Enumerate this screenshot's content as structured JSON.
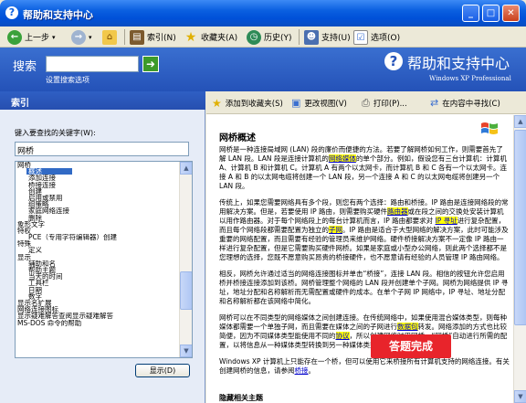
{
  "window": {
    "title": "帮助和支持中心"
  },
  "toolbar": {
    "back": "上一步",
    "index": "索引(N)",
    "favorites": "收藏夹(A)",
    "history": "历史(Y)",
    "support": "支持(U)",
    "options": "选项(O)"
  },
  "banner": {
    "search_label": "搜索",
    "search_value": "",
    "search_options": "设置搜索选项",
    "title": "帮助和支持中心",
    "subtitle": "Windows XP Professional"
  },
  "index_panel": {
    "heading": "索引",
    "prompt": "键入要查找的关键字(W):",
    "keyword": "网桥",
    "items": [
      {
        "label": "网桥",
        "indent": false
      },
      {
        "label": "概述",
        "indent": true,
        "selected": true
      },
      {
        "label": "添加连接",
        "indent": true
      },
      {
        "label": "桥接连接",
        "indent": true
      },
      {
        "label": "创建",
        "indent": true
      },
      {
        "label": "启用或禁用",
        "indent": true
      },
      {
        "label": "组策略",
        "indent": true
      },
      {
        "label": "家庭网络连接",
        "indent": true
      },
      {
        "label": "删除",
        "indent": true
      },
      {
        "label": "象形文字",
        "indent": false
      },
      {
        "label": "特权",
        "indent": false
      },
      {
        "label": "PCE（专用字符编辑器）创建",
        "indent": true
      },
      {
        "label": "特殊",
        "indent": false
      },
      {
        "label": "定义",
        "indent": true
      },
      {
        "label": "显示",
        "indent": false
      },
      {
        "label": "辅助和名",
        "indent": true
      },
      {
        "label": "帮助主题",
        "indent": true
      },
      {
        "label": "当天的时间",
        "indent": true
      },
      {
        "label": "工具栏",
        "indent": true
      },
      {
        "label": "日期",
        "indent": true
      },
      {
        "label": "数字",
        "indent": true
      },
      {
        "label": "显示名扩展",
        "indent": false
      },
      {
        "label": "网络连接图标",
        "indent": false
      },
      {
        "label": "显示疑难解答查阅显示疑难解答",
        "indent": false
      },
      {
        "label": "MS-DOS 命令的帮助",
        "indent": false
      }
    ],
    "show_button": "显示(D)"
  },
  "content_toolbar": {
    "add_favorite": "添加到收藏夹(S)",
    "change_view": "更改视图(V)",
    "print": "打印(P)...",
    "locate": "在内容中寻找(C)"
  },
  "article": {
    "title": "网桥概述",
    "p1_a": "网桥是一种连接局域网 (LAN) 段的廉价而便捷的方法。若要了解网桥如何工作，则需要首先了解 LAN 段。LAN 段是连接计算机的",
    "p1_link": "网络媒体",
    "p1_b": "的单个部分。例如，假设您有三台计算机：计算机 A、计算机 B 和计算机 C。计算机 A 有两个以太网卡，而计算机 B 和 C 各有一个以太网卡。连接 A 和 B 的以太网电缆将创建一个 LAN 段，另一个连接 A 和 C 的以太网电缆将创建另一个 LAN 段。",
    "p2_a": "传统上，如果您需要网络具有多个段，则您有两个选择：路由和桥接。IP 路由是连接网络段的常用解决方案。但是，若要使用 IP 路由，则需要购买硬件",
    "p2_link1": "路由器",
    "p2_b": "或在段之间的交换处安装计算机以用作路由器。对于每个网络段上的每台计算机而言，IP 路由都要求对 ",
    "p2_link2": "IP 寻址",
    "p2_c": "进行复杂配置，而且每个网络段都需要配置为独立的",
    "p2_link3": "子网",
    "p2_d": "。IP 路由是适合于大型网络的解决方案，此时可能涉及重要的网络配置，而且需要有经验的管理员来维护网络。硬件桥接解决方案不一定像 IP 路由一样进行复杂配置，但是它需要购买硬件网桥。如果是家庭或小型办公网络，则此两个选择都不是您理想的选择，您既不愿意购买昂贵的桥接硬件，也不愿意请有经验的人员管理 IP 路由网络。",
    "p3": "相反，网桥允许通过适当的网络连接图标并单击“桥接”，连接 LAN 段。相信的按钮允许您启用桥并桥接连接添加到该桥。网桥管理整个网络的 LAN 段并创建单个子网。网桥为网络提供 IP 寻址，地址分配和名称解析而无需配置或硬件的成本。在单个子网 IP 网络中，IP 寻址、地址分配和名称解析都在该网络中简化。",
    "p4_a": "网桥可以在不同类型的网络媒体之间创建连接。在传统网络中，如果使用混合媒体类型，则每种媒体都需要一个单独子网，而且需要在媒体之间的子网进行",
    "p4_link1": "数据包",
    "p4_b": "转发。网络添加的方式也比较简便，因为不同媒体类型能使用不同的",
    "p4_link2": "协议",
    "p4_c": "，所以创建网络时用网桥。“网桥”自动进行所需的配置，以将信息从一种媒体类型转换到另一种媒体类型。",
    "p5_a": "Windows XP 计算机上只能存在一个桥，但可以使用它来桥接所有计算机支持的网络连接。有关创建网桥的信息，请参阅",
    "p5_link": "桥接",
    "p5_b": "。"
  },
  "overlay": {
    "label": "答题完成"
  },
  "footer": {
    "text": "隐藏相关主题"
  }
}
